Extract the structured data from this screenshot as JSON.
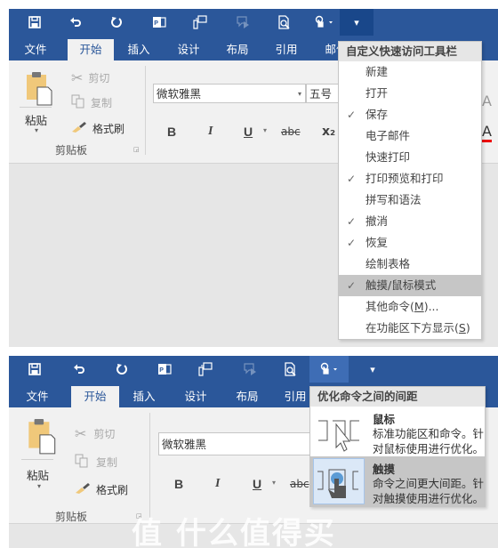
{
  "quick_access_toolbar": {
    "icons": [
      "save-icon",
      "undo-icon",
      "redo-icon",
      "publish-icon",
      "new-comment-icon",
      "reply-icon",
      "print-preview-icon",
      "touch-mouse-mode-icon",
      "customize-icon"
    ]
  },
  "tabs": [
    "文件",
    "开始",
    "插入",
    "设计",
    "布局",
    "引用",
    "邮件"
  ],
  "ribbon": {
    "clipboard": {
      "paste_label": "粘贴",
      "cut_label": "剪切",
      "copy_label": "复制",
      "format_painter_label": "格式刷",
      "group_label": "剪贴板"
    },
    "font": {
      "font_name": "微软雅黑",
      "font_size": "五号",
      "bold": "B",
      "italic": "I",
      "underline": "U",
      "strikethrough": "abc",
      "subscript": "x₂"
    }
  },
  "customize_menu": {
    "title": "自定义快速访问工具栏",
    "items": [
      {
        "label": "新建",
        "checked": false
      },
      {
        "label": "打开",
        "checked": false
      },
      {
        "label": "保存",
        "checked": true
      },
      {
        "label": "电子邮件",
        "checked": false
      },
      {
        "label": "快速打印",
        "checked": false
      },
      {
        "label": "打印预览和打印",
        "checked": true
      },
      {
        "label": "拼写和语法",
        "checked": false
      },
      {
        "label": "撤消",
        "checked": true
      },
      {
        "label": "恢复",
        "checked": true
      },
      {
        "label": "绘制表格",
        "checked": false
      },
      {
        "label": "触摸/鼠标模式",
        "checked": true,
        "highlighted": true
      }
    ],
    "more_commands_prefix": "其他命令(",
    "more_commands_key": "M",
    "more_commands_suffix": ")...",
    "show_below_prefix": "在功能区下方显示(",
    "show_below_key": "S",
    "show_below_suffix": ")"
  },
  "spacing_menu": {
    "title": "优化命令之间的间距",
    "options": [
      {
        "title": "鼠标",
        "description": "标准功能区和命令。针对鼠标使用进行优化。",
        "selected": false
      },
      {
        "title": "触摸",
        "description": "命令之间更大间距。针对触摸使用进行优化。",
        "selected": true
      }
    ]
  },
  "watermark": "值 什么值得买",
  "checkmark": "✓",
  "colors": {
    "brand_blue": "#2b579a",
    "ribbon_bg": "#f1f1f1",
    "menu_highlight": "#c6c6c6"
  }
}
